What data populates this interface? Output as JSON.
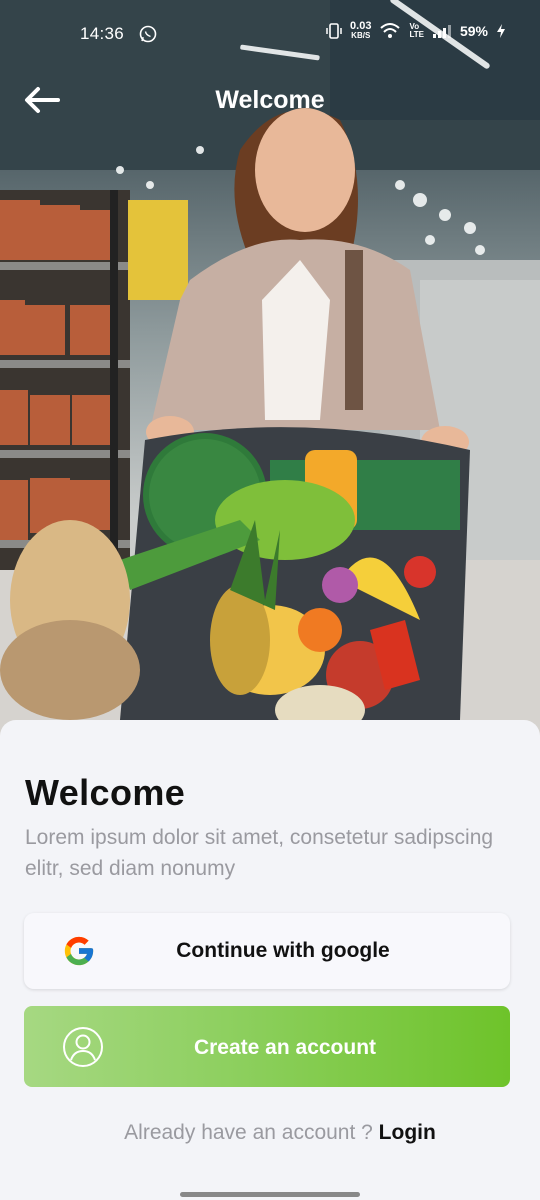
{
  "status_bar": {
    "time": "14:36",
    "net_speed": "0.03",
    "net_speed_unit": "KB/S",
    "volte_top": "Vo",
    "volte_bottom": "LTE",
    "battery": "59%"
  },
  "top_bar": {
    "title": "Welcome"
  },
  "sheet": {
    "title": "Welcome",
    "description": "Lorem ipsum dolor sit amet, consetetur sadipscing elitr, sed diam nonumy",
    "google_button_label": "Continue with google",
    "create_button_label": "Create an account",
    "login_prompt": "Already have an account ?",
    "login_link": "Login"
  },
  "colors": {
    "accent_green": "#6ec32a",
    "text_muted": "#9a9aa0",
    "sheet_bg": "#f3f4f8"
  }
}
